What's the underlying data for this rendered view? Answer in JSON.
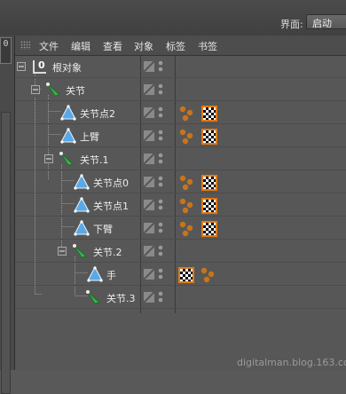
{
  "header": {
    "interface_label": "界面:",
    "interface_value": "启动"
  },
  "left_strip": {
    "icon_glyph": "0"
  },
  "menu": {
    "items": [
      "文件",
      "编辑",
      "查看",
      "对象",
      "标签",
      "书签"
    ]
  },
  "tree": {
    "rows": [
      {
        "label": "根对象",
        "icon": "null-object-icon",
        "expander": "minus"
      },
      {
        "label": "关节",
        "icon": "joint-icon",
        "expander": "minus"
      },
      {
        "label": "关节点2",
        "icon": "polygon-object-icon",
        "expander": "none"
      },
      {
        "label": "上臂",
        "icon": "polygon-object-icon",
        "expander": "none"
      },
      {
        "label": "关节.1",
        "icon": "joint-icon",
        "expander": "minus"
      },
      {
        "label": "关节点0",
        "icon": "polygon-object-icon",
        "expander": "none"
      },
      {
        "label": "关节点1",
        "icon": "polygon-object-icon",
        "expander": "none"
      },
      {
        "label": "下臂",
        "icon": "polygon-object-icon",
        "expander": "none"
      },
      {
        "label": "关节.2",
        "icon": "joint-icon",
        "expander": "minus"
      },
      {
        "label": "手",
        "icon": "polygon-object-icon",
        "expander": "none"
      },
      {
        "label": "关节.3",
        "icon": "joint-icon",
        "expander": "none"
      }
    ],
    "tags": {
      "weight_tag_icon": "weight-tag-icon",
      "material_tag_icon": "checker-texture-tag-icon",
      "accent_color": "#e07a16"
    }
  },
  "watermark": "digitalman.blog.163.com",
  "colors": {
    "panel_bg": "#575757",
    "menubar_bg": "#4d4d4d",
    "joint_green": "#3fb34a",
    "polygon_blue": "#5aa9e6",
    "weight_orange": "#c7741d"
  }
}
